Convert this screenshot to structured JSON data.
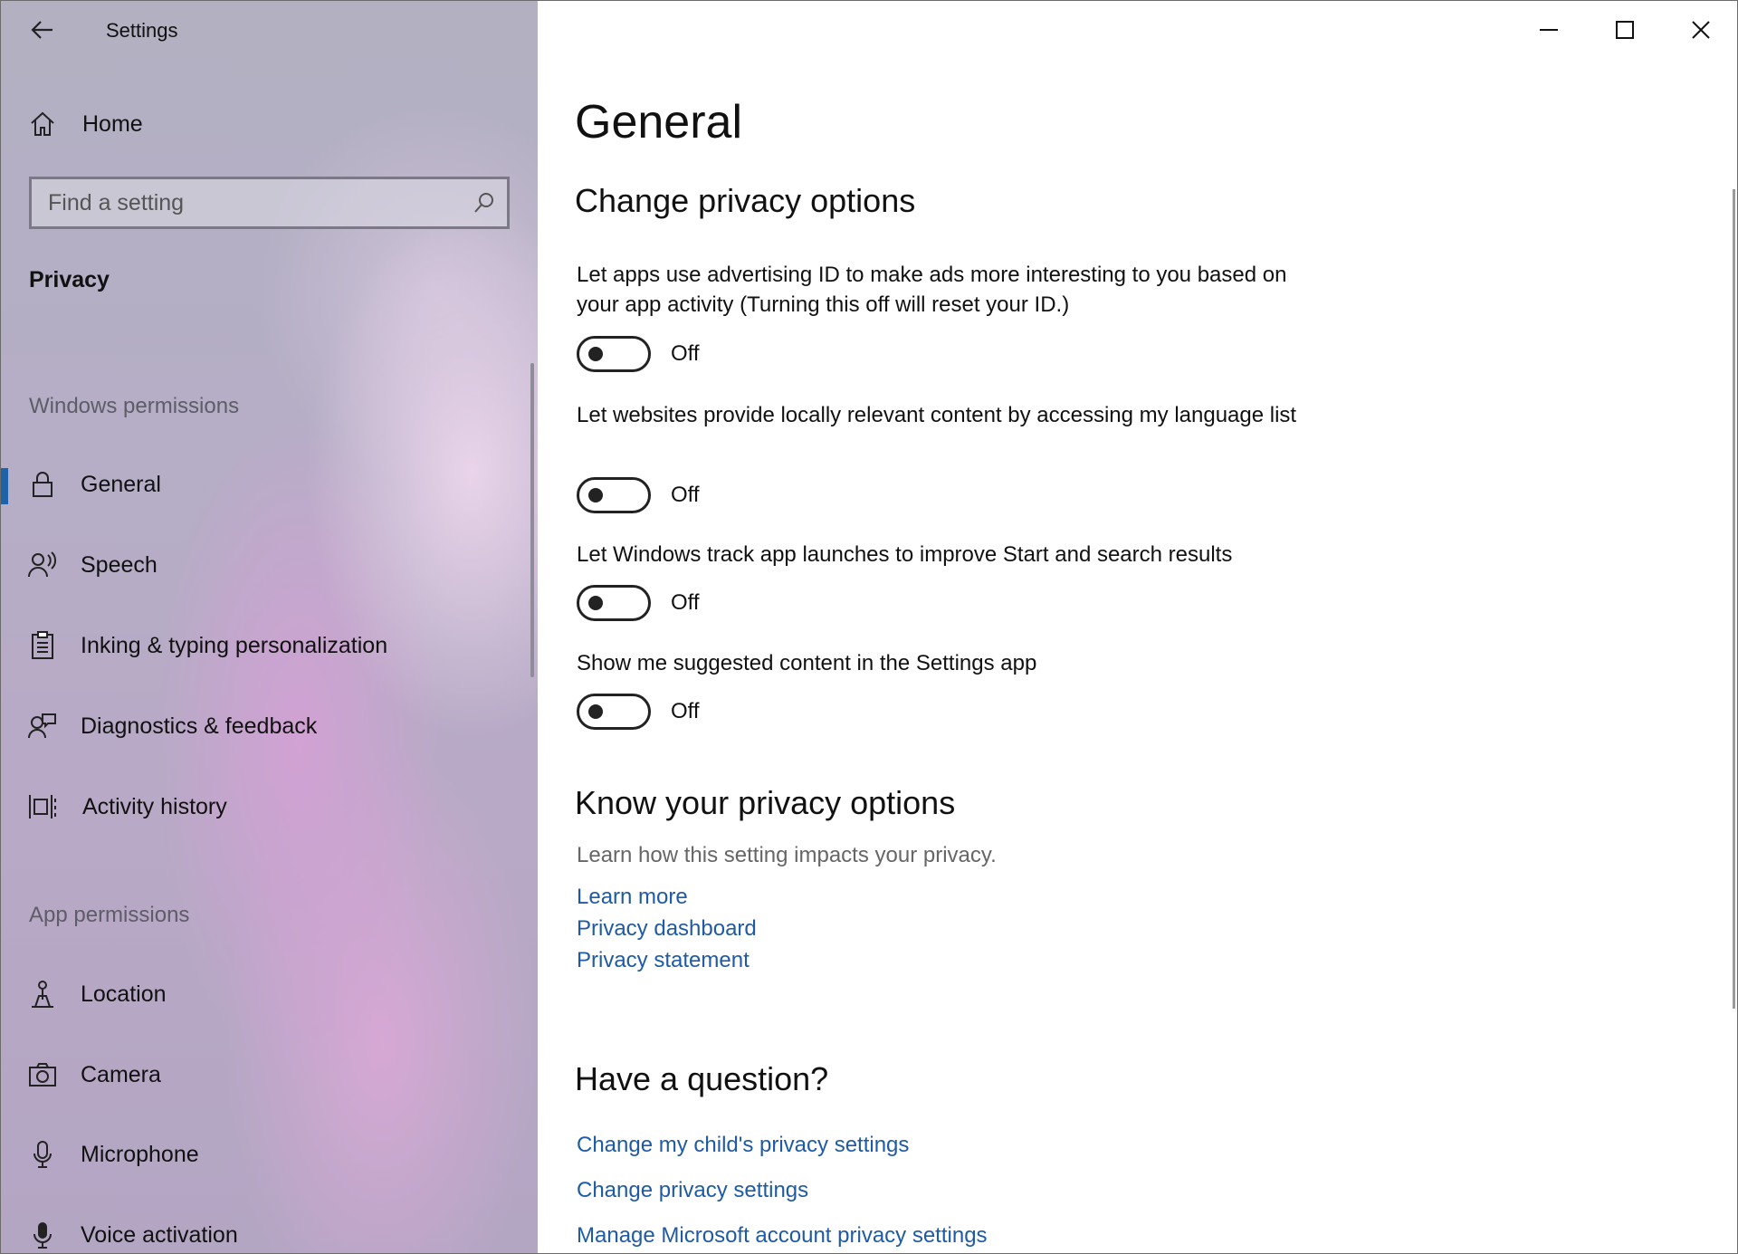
{
  "window": {
    "title": "Settings",
    "controls": {
      "minimize": "minimize",
      "maximize": "maximize",
      "close": "close"
    }
  },
  "sidebar": {
    "home": "Home",
    "search_placeholder": "Find a setting",
    "category": "Privacy",
    "windows_permissions_heading": "Windows permissions",
    "windows_permissions": [
      {
        "label": "General",
        "icon": "lock-icon",
        "selected": true
      },
      {
        "label": "Speech",
        "icon": "speech-icon"
      },
      {
        "label": "Inking & typing personalization",
        "icon": "inking-icon"
      },
      {
        "label": "Diagnostics & feedback",
        "icon": "diagnostics-icon"
      },
      {
        "label": "Activity history",
        "icon": "activity-history-icon"
      }
    ],
    "app_permissions_heading": "App permissions",
    "app_permissions": [
      {
        "label": "Location",
        "icon": "location-icon"
      },
      {
        "label": "Camera",
        "icon": "camera-icon"
      },
      {
        "label": "Microphone",
        "icon": "microphone-icon"
      },
      {
        "label": "Voice activation",
        "icon": "voice-activation-icon"
      }
    ]
  },
  "main": {
    "title": "General",
    "change_heading": "Change privacy options",
    "options": [
      {
        "text": "Let apps use advertising ID to make ads more interesting to you based on your app activity (Turning this off will reset your ID.)",
        "state": "Off"
      },
      {
        "text": "Let websites provide locally relevant content by accessing my language list",
        "state": "Off"
      },
      {
        "text": "Let Windows track app launches to improve Start and search results",
        "state": "Off"
      },
      {
        "text": "Show me suggested content in the Settings app",
        "state": "Off"
      }
    ],
    "know_heading": "Know your privacy options",
    "know_desc": "Learn how this setting impacts your privacy.",
    "know_links": [
      "Learn more",
      "Privacy dashboard",
      "Privacy statement"
    ],
    "question_heading": "Have a question?",
    "question_links": [
      "Change my child's privacy settings",
      "Change privacy settings",
      "Manage Microsoft account privacy settings"
    ]
  },
  "colors": {
    "accent": "#1e62a8",
    "link": "#1f5aa6"
  }
}
